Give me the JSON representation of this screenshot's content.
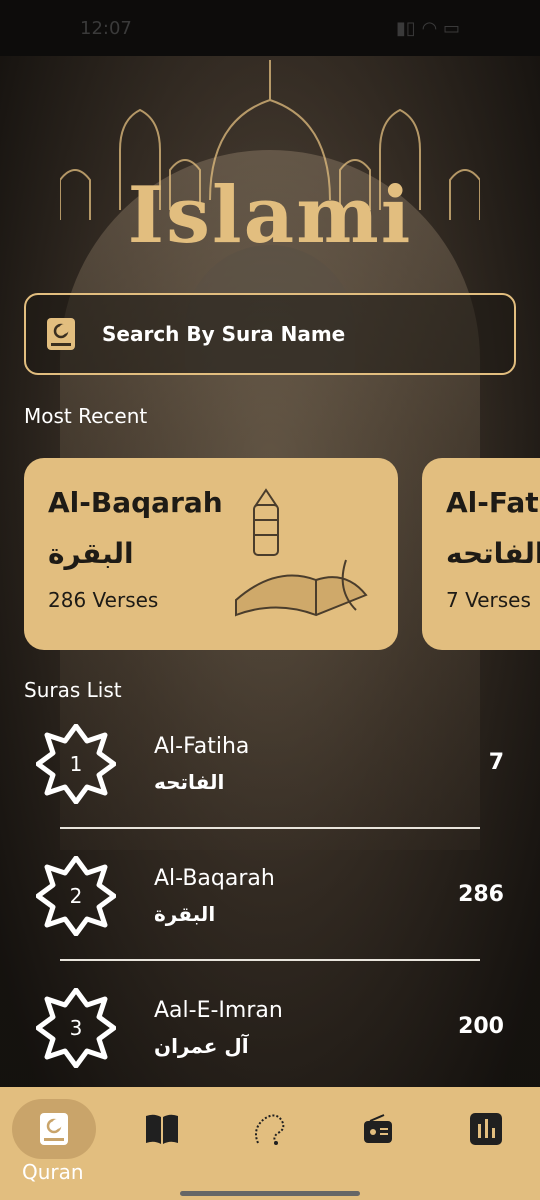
{
  "status_bar": {
    "time": "12:07"
  },
  "app": {
    "logo_text": "Islami"
  },
  "search": {
    "placeholder": "Search By Sura Name"
  },
  "most_recent": {
    "title": "Most Recent",
    "cards": [
      {
        "name_en": "Al-Baqarah",
        "name_ar": "البقرة",
        "verses": "286 Verses"
      },
      {
        "name_en": "Al-Fatiha",
        "name_ar": "الفاتحه",
        "verses": "7 Verses"
      }
    ]
  },
  "suras_list": {
    "title": "Suras List",
    "items": [
      {
        "number": "1",
        "name_en": "Al-Fatiha",
        "name_ar": "الفاتحه",
        "verses": "7"
      },
      {
        "number": "2",
        "name_en": "Al-Baqarah",
        "name_ar": "البقرة",
        "verses": "286"
      },
      {
        "number": "3",
        "name_en": "Aal-E-Imran",
        "name_ar": "آل عمران",
        "verses": "200"
      }
    ]
  },
  "bottom_nav": {
    "items": [
      {
        "icon": "quran-icon",
        "label": "Quran",
        "active": true
      },
      {
        "icon": "book-icon",
        "label": "",
        "active": false
      },
      {
        "icon": "sebha-icon",
        "label": "",
        "active": false
      },
      {
        "icon": "radio-icon",
        "label": "",
        "active": false
      },
      {
        "icon": "time-icon",
        "label": "",
        "active": false
      }
    ]
  },
  "colors": {
    "accent": "#E2BE7F",
    "background": "#202020",
    "text": "#FFFFFF"
  }
}
